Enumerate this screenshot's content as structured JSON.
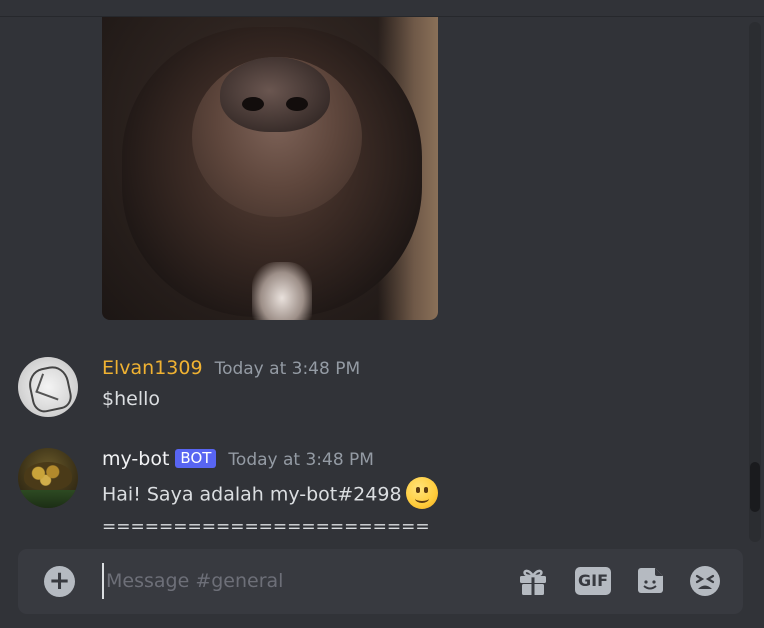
{
  "channel": "general",
  "messages": [
    {
      "author": "Elvan1309",
      "timestamp": "Today at 3:48 PM",
      "text": "$hello"
    },
    {
      "author": "my-bot",
      "bot_tag": "BOT",
      "timestamp": "Today at 3:48 PM",
      "text": "Hai! Saya adalah my-bot#2498",
      "divider": "======================="
    }
  ],
  "composer": {
    "placeholder": "Message #general",
    "value": "",
    "gif_label": "GIF"
  },
  "colors": {
    "background": "#313338",
    "composer": "#383a40",
    "username_user": "#f0b232",
    "bot_tag": "#5865f2",
    "timestamp": "#949ba4"
  },
  "icons": [
    "plus-icon",
    "gift-icon",
    "gif-icon",
    "sticker-icon",
    "emoji-icon",
    "slightly-smiling-emoji"
  ]
}
